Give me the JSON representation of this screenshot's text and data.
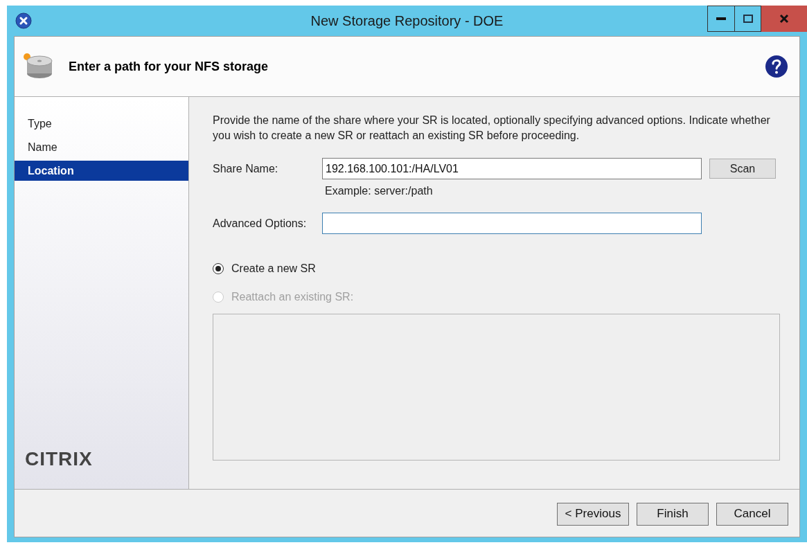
{
  "window": {
    "title": "New Storage Repository - DOE"
  },
  "header": {
    "title": "Enter a path for your NFS storage"
  },
  "sidebar": {
    "items": [
      {
        "label": "Type",
        "selected": false
      },
      {
        "label": "Name",
        "selected": false
      },
      {
        "label": "Location",
        "selected": true
      }
    ],
    "logo": "CITRIX"
  },
  "intro": "Provide the name of the share where your SR is located, optionally specifying advanced options. Indicate whether you wish to create a new SR or reattach an existing SR before proceeding.",
  "share_name": {
    "label": "Share Name:",
    "value": "192.168.100.101:/HA/LV01",
    "hint": "Example: server:/path",
    "button": "Scan"
  },
  "advanced_options": {
    "label": "Advanced Options:"
  },
  "options": [
    {
      "label": "Create a new SR",
      "selected": true,
      "disabled": false
    },
    {
      "label": "Reattach an existing SR:",
      "selected": false,
      "disabled": true
    }
  ],
  "buttons": [
    "< Previous",
    "Finish",
    "Cancel"
  ]
}
